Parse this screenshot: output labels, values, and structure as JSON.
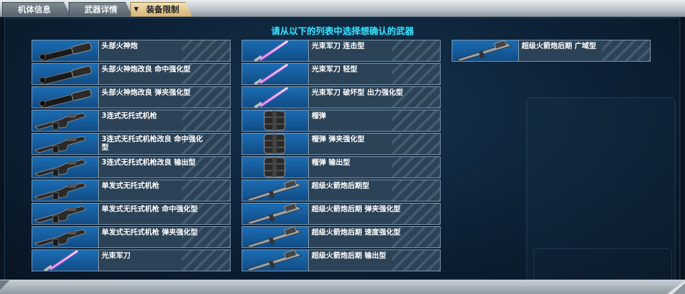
{
  "tabs": [
    {
      "label": "机体信息",
      "active": false
    },
    {
      "label": "武器详情",
      "active": false
    },
    {
      "label": "装备限制",
      "active": true
    }
  ],
  "heading": "请从以下的列表中选择想确认的武器",
  "columns": [
    [
      {
        "name": "头部火神炮",
        "icon": "head-vulcan-icon"
      },
      {
        "name": "头部火神炮改良 命中强化型",
        "icon": "head-vulcan-icon"
      },
      {
        "name": "头部火神炮改良 弹夹强化型",
        "icon": "head-vulcan-icon"
      },
      {
        "name": "3连式无托式机枪",
        "icon": "bullpup-machine-gun-icon"
      },
      {
        "name": "3连式无托式机枪改良 命中强化型",
        "icon": "bullpup-machine-gun-icon"
      },
      {
        "name": "3连式无托式机枪改良 输出型",
        "icon": "bullpup-machine-gun-icon"
      },
      {
        "name": "单发式无托式机枪",
        "icon": "bullpup-machine-gun-icon"
      },
      {
        "name": "单发式无托式机枪 命中强化型",
        "icon": "bullpup-machine-gun-icon"
      },
      {
        "name": "单发式无托式机枪 弹夹强化型",
        "icon": "bullpup-machine-gun-icon"
      },
      {
        "name": "光束军刀",
        "icon": "beam-saber-icon"
      }
    ],
    [
      {
        "name": "光束军刀 连击型",
        "icon": "beam-saber-icon"
      },
      {
        "name": "光束军刀 轻型",
        "icon": "beam-saber-icon"
      },
      {
        "name": "光束军刀 破坏型 出力强化型",
        "icon": "beam-saber-icon"
      },
      {
        "name": "榴弹",
        "icon": "grenade-icon"
      },
      {
        "name": "榴弹 弹夹强化型",
        "icon": "grenade-icon"
      },
      {
        "name": "榴弹 输出型",
        "icon": "grenade-icon"
      },
      {
        "name": "超级火箭炮后期型",
        "icon": "hyper-bazooka-icon"
      },
      {
        "name": "超级火箭炮后期 弹夹强化型",
        "icon": "hyper-bazooka-icon"
      },
      {
        "name": "超级火箭炮后期 速度强化型",
        "icon": "hyper-bazooka-icon"
      },
      {
        "name": "超级火箭炮后期 输出型",
        "icon": "hyper-bazooka-icon"
      }
    ],
    [
      {
        "name": "超级火箭炮后期 广域型",
        "icon": "hyper-bazooka-icon"
      }
    ]
  ]
}
